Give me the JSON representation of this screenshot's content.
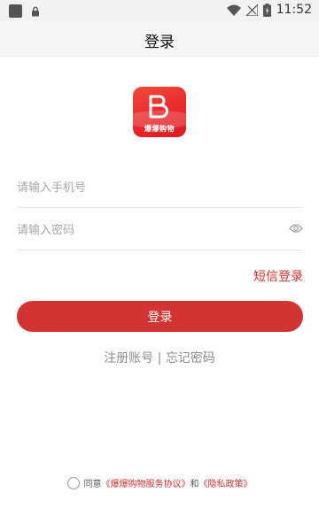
{
  "status_bar": {
    "time": "11:52"
  },
  "header": {
    "title": "登录"
  },
  "logo": {
    "text": "爆爆购物"
  },
  "form": {
    "phone_placeholder": "请输入手机号",
    "password_placeholder": "请输入密码"
  },
  "sms_login_label": "短信登录",
  "login_button_label": "登录",
  "links": {
    "register": "注册账号",
    "separator": " | ",
    "forgot": "忘记密码"
  },
  "agreement": {
    "prefix": "同意",
    "service_terms": "《爆爆购物服务协议》",
    "and": "和",
    "privacy_policy": "《隐私政策》"
  },
  "colors": {
    "brand_red": "#d23434",
    "link_red": "#d3312f"
  }
}
